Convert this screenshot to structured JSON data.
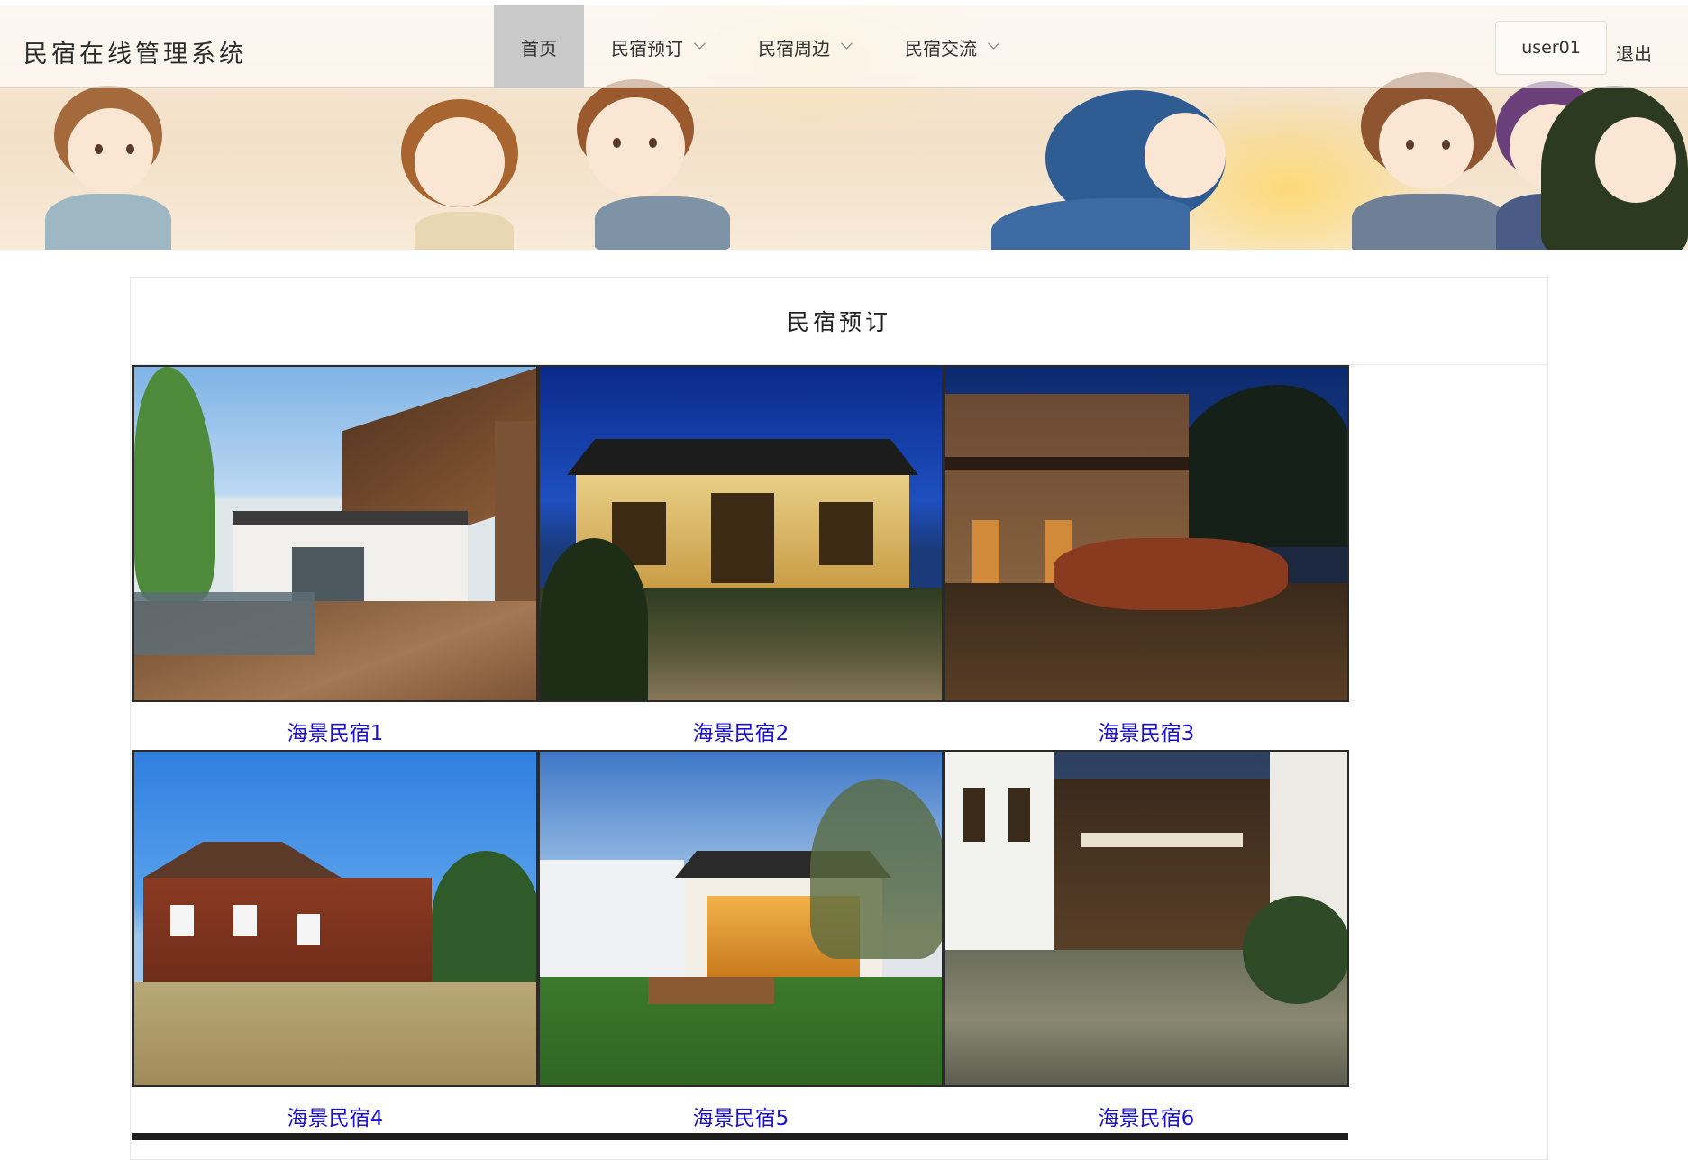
{
  "header": {
    "logo": "民宿在线管理系统",
    "menu": [
      {
        "label": "首页",
        "active": true,
        "dropdown": false
      },
      {
        "label": "民宿预订",
        "active": false,
        "dropdown": true
      },
      {
        "label": "民宿周边",
        "active": false,
        "dropdown": true
      },
      {
        "label": "民宿交流",
        "active": false,
        "dropdown": true
      }
    ],
    "user": "user01",
    "logout": "退出"
  },
  "section": {
    "title": "民宿预订",
    "items": [
      {
        "name": "海景民宿1"
      },
      {
        "name": "海景民宿2"
      },
      {
        "name": "海景民宿3"
      },
      {
        "name": "海景民宿4"
      },
      {
        "name": "海景民宿5"
      },
      {
        "name": "海景民宿6"
      }
    ]
  },
  "colors": {
    "link": "#1a10d6",
    "active_menu_bg": "#c9c9c9"
  }
}
